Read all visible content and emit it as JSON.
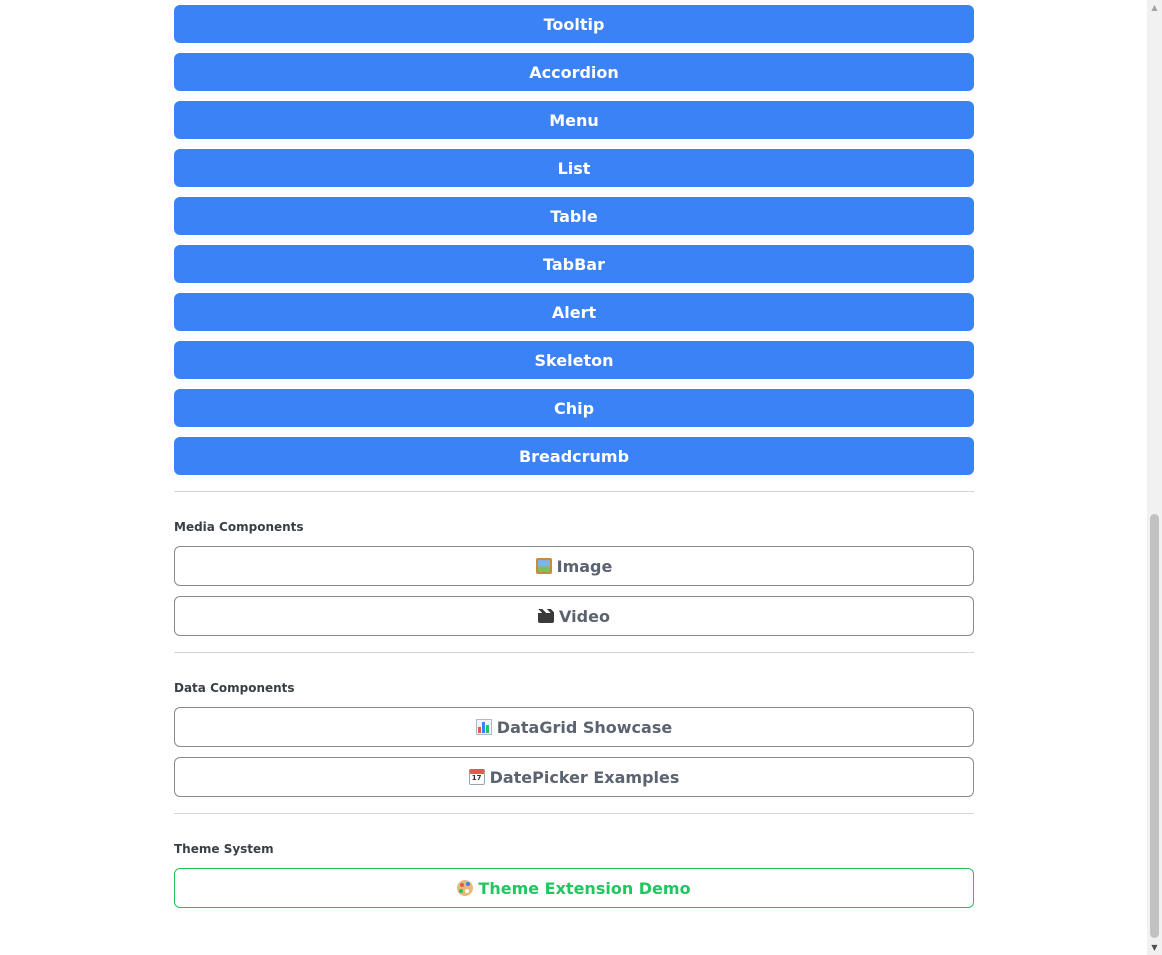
{
  "component_buttons": [
    {
      "label": "Tooltip"
    },
    {
      "label": "Accordion"
    },
    {
      "label": "Menu"
    },
    {
      "label": "List"
    },
    {
      "label": "Table"
    },
    {
      "label": "TabBar"
    },
    {
      "label": "Alert"
    },
    {
      "label": "Skeleton"
    },
    {
      "label": "Chip"
    },
    {
      "label": "Breadcrumb"
    }
  ],
  "media": {
    "title": "Media Components",
    "image_label": "Image",
    "image_icon": "framed-picture-icon",
    "video_label": "Video",
    "video_icon": "clapper-board-icon"
  },
  "data_components": {
    "title": "Data Components",
    "datagrid_label": "DataGrid Showcase",
    "datagrid_icon": "bar-chart-icon",
    "datepicker_label": "DatePicker Examples",
    "datepicker_icon": "calendar-icon",
    "calendar_day": "17"
  },
  "theme": {
    "title": "Theme System",
    "demo_label": "Theme Extension Demo",
    "demo_icon": "palette-icon"
  },
  "colors": {
    "primary": "#3b82f6",
    "success": "#22c55e",
    "outline_text": "#5c6370"
  }
}
